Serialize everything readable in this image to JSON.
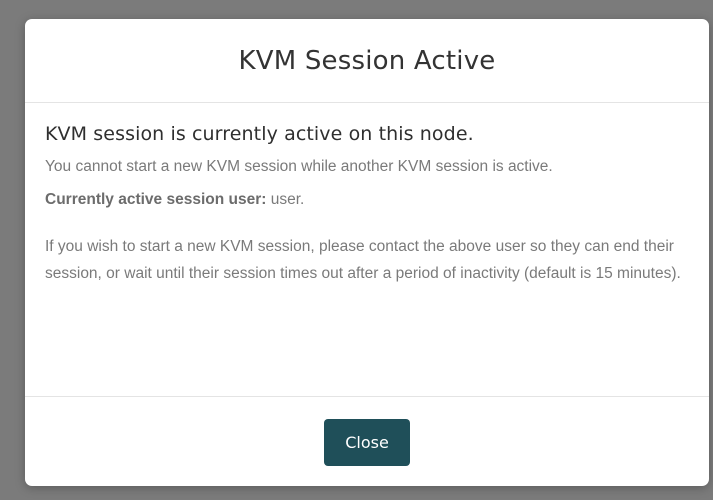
{
  "modal": {
    "title": "KVM Session Active",
    "heading": "KVM session is currently active on this node.",
    "subtext": "You cannot start a new KVM session while another KVM session is active.",
    "active_user_label": "Currently active session user:",
    "active_user_value": " user.",
    "info": "If you wish to start a new KVM session, please contact the above user so they can end their session, or wait until their session times out after a period of inactivity (default is 15 minutes).",
    "close_label": "Close"
  },
  "colors": {
    "backdrop": "#7b7b7b",
    "button_bg": "#1f4f59",
    "button_text": "#ffffff"
  }
}
